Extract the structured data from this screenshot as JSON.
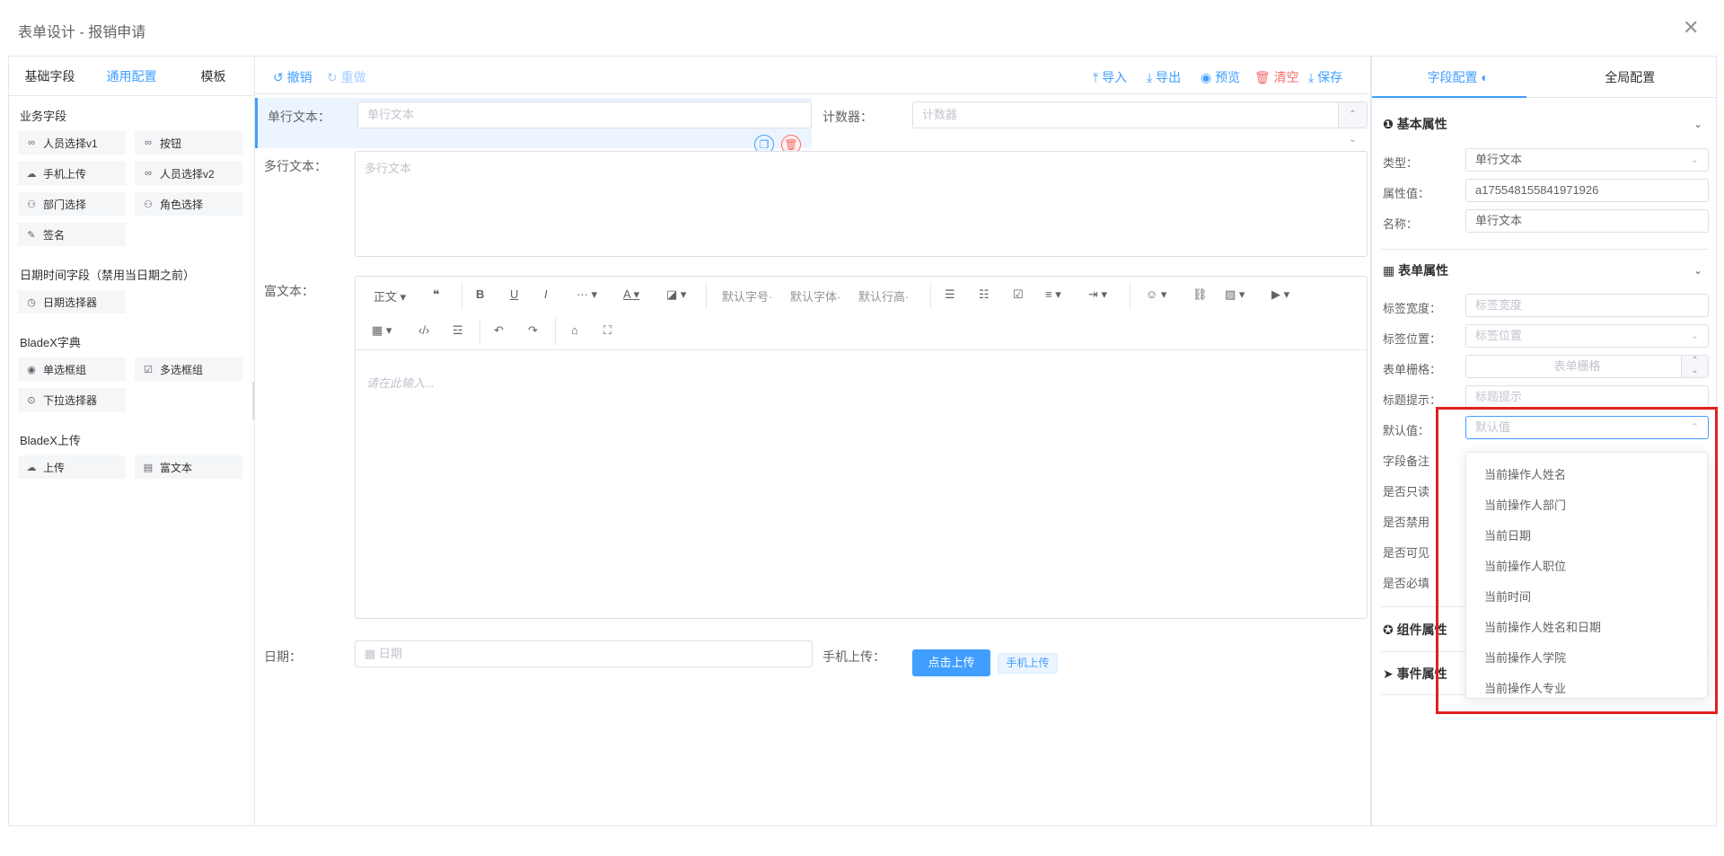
{
  "dialog": {
    "title": "表单设计 - 报销申请",
    "close_label": "✕"
  },
  "left": {
    "tabs": [
      "基础字段",
      "通用配置",
      "模板"
    ],
    "active_tab": 1,
    "groups": [
      {
        "title": "业务字段",
        "items": [
          {
            "label": "人员选择v1",
            "icon": "link-icon"
          },
          {
            "label": "按钮",
            "icon": "link-icon"
          },
          {
            "label": "手机上传",
            "icon": "cloud-upload-icon"
          },
          {
            "label": "人员选择v2",
            "icon": "link-icon"
          },
          {
            "label": "部门选择",
            "icon": "user-icon"
          },
          {
            "label": "角色选择",
            "icon": "user-icon"
          },
          {
            "label": "签名",
            "icon": "pen-icon"
          }
        ]
      },
      {
        "title": "日期时间字段（禁用当日期之前）",
        "items": [
          {
            "label": "日期选择器",
            "icon": "clock-icon"
          }
        ]
      },
      {
        "title": "BladeX字典",
        "items": [
          {
            "label": "单选框组",
            "icon": "radio-icon"
          },
          {
            "label": "多选框组",
            "icon": "checkbox-icon"
          },
          {
            "label": "下拉选择器",
            "icon": "chevron-circle-icon"
          }
        ]
      },
      {
        "title": "BladeX上传",
        "items": [
          {
            "label": "上传",
            "icon": "cloud-upload-icon"
          },
          {
            "label": "富文本",
            "icon": "richtext-icon"
          }
        ]
      }
    ]
  },
  "toolbar": {
    "undo": "撤销",
    "redo": "重做",
    "import": "导入",
    "export": "导出",
    "preview": "预览",
    "clear": "清空",
    "save": "保存"
  },
  "form": {
    "single_label": "单行文本：",
    "single_placeholder": "单行文本",
    "counter_label": "计数器：",
    "counter_placeholder": "计数器",
    "multi_label": "多行文本：",
    "multi_placeholder": "多行文本",
    "rich_label": "富文本：",
    "rich_toolbar": {
      "heading": "正文",
      "font_size": "默认字号",
      "font_family": "默认字体",
      "line_height": "默认行高"
    },
    "rich_placeholder": "请在此输入...",
    "date_label": "日期：",
    "date_placeholder": "日期",
    "mobile_label": "手机上传：",
    "upload_button": "点击上传",
    "upload_tag": "手机上传"
  },
  "right": {
    "tabs": [
      "字段配置",
      "全局配置"
    ],
    "basic_title": "基本属性",
    "type_label": "类型：",
    "type_value": "单行文本",
    "prop_label": "属性值：",
    "prop_value": "a175548155841971926",
    "name_label": "名称：",
    "name_value": "单行文本",
    "form_title": "表单属性",
    "label_width_label": "标签宽度：",
    "label_width_ph": "标签宽度",
    "label_pos_label": "标签位置：",
    "label_pos_ph": "标签位置",
    "grid_label": "表单栅格：",
    "grid_ph": "表单栅格",
    "tip_label": "标题提示：",
    "tip_ph": "标题提示",
    "default_label": "默认值：",
    "default_ph": "默认值",
    "note_label": "字段备注",
    "readonly_label": "是否只读",
    "disabled_label": "是否禁用",
    "visible_label": "是否可见",
    "required_label": "是否必填",
    "component_title": "组件属性",
    "event_title": "事件属性"
  },
  "dropdown": {
    "options": [
      "当前操作人姓名",
      "当前操作人部门",
      "当前日期",
      "当前操作人职位",
      "当前时间",
      "当前操作人姓名和日期",
      "当前操作人学院",
      "当前操作人专业"
    ]
  },
  "colors": {
    "accent": "#409eff",
    "danger": "#f56c6c",
    "highlight": "#e02020"
  }
}
